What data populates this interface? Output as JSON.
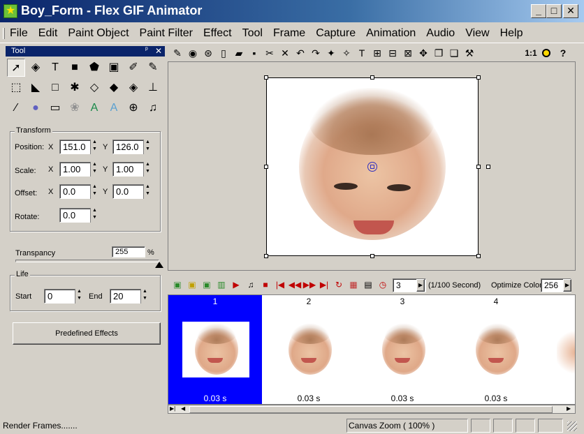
{
  "window": {
    "title": "Boy_Form - Flex GIF Animator",
    "minimize": "_",
    "maximize": "□",
    "close": "✕"
  },
  "menu": [
    "File",
    "Edit",
    "Paint Object",
    "Paint Filter",
    "Effect",
    "Tool",
    "Frame",
    "Capture",
    "Animation",
    "Audio",
    "View",
    "Help"
  ],
  "tool_panel": {
    "title": "Tool",
    "pin": "ᵖ",
    "close": "✕",
    "tools": [
      "select-arrow",
      "node-edit",
      "text",
      "rectangle-filled",
      "polygon-brush",
      "image-insert",
      "sparkle-pen",
      "sparkle-pen-2",
      "marquee-select",
      "crop-select",
      "rectangle-outline",
      "magic-wand",
      "eraser",
      "fill-bucket",
      "color-bucket",
      "stamp",
      "eyedropper",
      "color-picker",
      "frame-rect",
      "blur",
      "gradient-text",
      "outline-text",
      "zoom",
      "music-note"
    ],
    "transform": {
      "legend": "Transform",
      "position_label": "Position:",
      "scale_label": "Scale:",
      "offset_label": "Offset:",
      "rotate_label": "Rotate:",
      "x_label": "X",
      "y_label": "Y",
      "position_x": "151.0",
      "position_y": "126.0",
      "scale_x": "1.00",
      "scale_y": "1.00",
      "offset_x": "0.0",
      "offset_y": "0.0",
      "rotate": "0.0"
    },
    "transparency": {
      "label": "Transpancy",
      "value": "255",
      "unit": "%",
      "level": 1.0
    },
    "life": {
      "legend": "Life",
      "start_label": "Start",
      "start": "0",
      "end_label": "End",
      "end": "20"
    },
    "predefined_effects": "Predefined Effects"
  },
  "toolbar": {
    "zoom_reset": "1:1",
    "help": "?"
  },
  "timeline": {
    "frame_delay": "3",
    "unit_label": "(1/100 Second)",
    "optimize_label": "Optimize Color",
    "optimize_value": "256",
    "frames": [
      {
        "number": "1",
        "duration": "0.03 s",
        "selected": true
      },
      {
        "number": "2",
        "duration": "0.03 s",
        "selected": false
      },
      {
        "number": "3",
        "duration": "0.03 s",
        "selected": false
      },
      {
        "number": "4",
        "duration": "0.03 s",
        "selected": false
      }
    ]
  },
  "status": {
    "message": "Render Frames.......",
    "zoom": "Canvas Zoom ( 100% )"
  },
  "colors": {
    "titlebar": "#0a246a",
    "selection": "#0000ff",
    "face_skin": "#e6b48f",
    "hair": "#9b6a45"
  }
}
